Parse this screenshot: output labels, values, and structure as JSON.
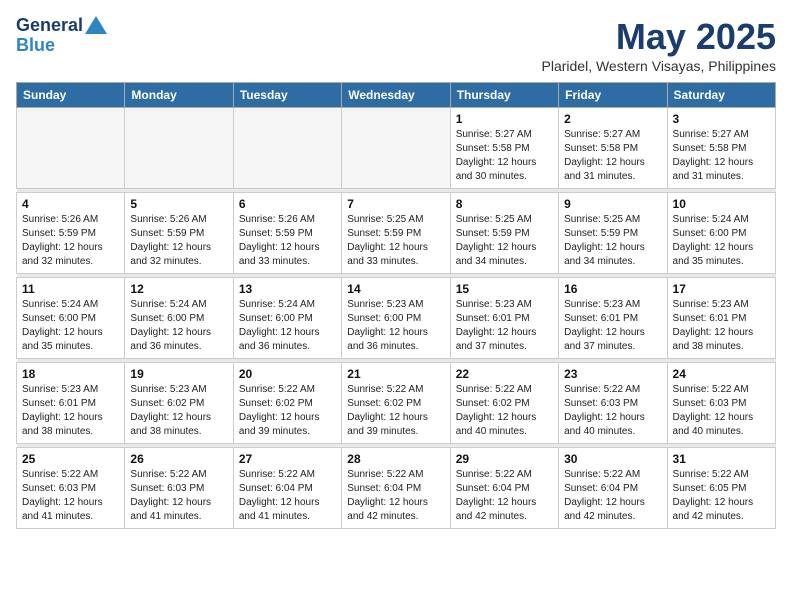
{
  "logo": {
    "line1": "General",
    "line2": "Blue"
  },
  "calendar": {
    "title": "May 2025",
    "subtitle": "Plaridel, Western Visayas, Philippines",
    "days_of_week": [
      "Sunday",
      "Monday",
      "Tuesday",
      "Wednesday",
      "Thursday",
      "Friday",
      "Saturday"
    ],
    "weeks": [
      [
        {
          "num": "",
          "info": ""
        },
        {
          "num": "",
          "info": ""
        },
        {
          "num": "",
          "info": ""
        },
        {
          "num": "",
          "info": ""
        },
        {
          "num": "1",
          "info": "Sunrise: 5:27 AM\nSunset: 5:58 PM\nDaylight: 12 hours and 30 minutes."
        },
        {
          "num": "2",
          "info": "Sunrise: 5:27 AM\nSunset: 5:58 PM\nDaylight: 12 hours and 31 minutes."
        },
        {
          "num": "3",
          "info": "Sunrise: 5:27 AM\nSunset: 5:58 PM\nDaylight: 12 hours and 31 minutes."
        }
      ],
      [
        {
          "num": "4",
          "info": "Sunrise: 5:26 AM\nSunset: 5:59 PM\nDaylight: 12 hours and 32 minutes."
        },
        {
          "num": "5",
          "info": "Sunrise: 5:26 AM\nSunset: 5:59 PM\nDaylight: 12 hours and 32 minutes."
        },
        {
          "num": "6",
          "info": "Sunrise: 5:26 AM\nSunset: 5:59 PM\nDaylight: 12 hours and 33 minutes."
        },
        {
          "num": "7",
          "info": "Sunrise: 5:25 AM\nSunset: 5:59 PM\nDaylight: 12 hours and 33 minutes."
        },
        {
          "num": "8",
          "info": "Sunrise: 5:25 AM\nSunset: 5:59 PM\nDaylight: 12 hours and 34 minutes."
        },
        {
          "num": "9",
          "info": "Sunrise: 5:25 AM\nSunset: 5:59 PM\nDaylight: 12 hours and 34 minutes."
        },
        {
          "num": "10",
          "info": "Sunrise: 5:24 AM\nSunset: 6:00 PM\nDaylight: 12 hours and 35 minutes."
        }
      ],
      [
        {
          "num": "11",
          "info": "Sunrise: 5:24 AM\nSunset: 6:00 PM\nDaylight: 12 hours and 35 minutes."
        },
        {
          "num": "12",
          "info": "Sunrise: 5:24 AM\nSunset: 6:00 PM\nDaylight: 12 hours and 36 minutes."
        },
        {
          "num": "13",
          "info": "Sunrise: 5:24 AM\nSunset: 6:00 PM\nDaylight: 12 hours and 36 minutes."
        },
        {
          "num": "14",
          "info": "Sunrise: 5:23 AM\nSunset: 6:00 PM\nDaylight: 12 hours and 36 minutes."
        },
        {
          "num": "15",
          "info": "Sunrise: 5:23 AM\nSunset: 6:01 PM\nDaylight: 12 hours and 37 minutes."
        },
        {
          "num": "16",
          "info": "Sunrise: 5:23 AM\nSunset: 6:01 PM\nDaylight: 12 hours and 37 minutes."
        },
        {
          "num": "17",
          "info": "Sunrise: 5:23 AM\nSunset: 6:01 PM\nDaylight: 12 hours and 38 minutes."
        }
      ],
      [
        {
          "num": "18",
          "info": "Sunrise: 5:23 AM\nSunset: 6:01 PM\nDaylight: 12 hours and 38 minutes."
        },
        {
          "num": "19",
          "info": "Sunrise: 5:23 AM\nSunset: 6:02 PM\nDaylight: 12 hours and 38 minutes."
        },
        {
          "num": "20",
          "info": "Sunrise: 5:22 AM\nSunset: 6:02 PM\nDaylight: 12 hours and 39 minutes."
        },
        {
          "num": "21",
          "info": "Sunrise: 5:22 AM\nSunset: 6:02 PM\nDaylight: 12 hours and 39 minutes."
        },
        {
          "num": "22",
          "info": "Sunrise: 5:22 AM\nSunset: 6:02 PM\nDaylight: 12 hours and 40 minutes."
        },
        {
          "num": "23",
          "info": "Sunrise: 5:22 AM\nSunset: 6:03 PM\nDaylight: 12 hours and 40 minutes."
        },
        {
          "num": "24",
          "info": "Sunrise: 5:22 AM\nSunset: 6:03 PM\nDaylight: 12 hours and 40 minutes."
        }
      ],
      [
        {
          "num": "25",
          "info": "Sunrise: 5:22 AM\nSunset: 6:03 PM\nDaylight: 12 hours and 41 minutes."
        },
        {
          "num": "26",
          "info": "Sunrise: 5:22 AM\nSunset: 6:03 PM\nDaylight: 12 hours and 41 minutes."
        },
        {
          "num": "27",
          "info": "Sunrise: 5:22 AM\nSunset: 6:04 PM\nDaylight: 12 hours and 41 minutes."
        },
        {
          "num": "28",
          "info": "Sunrise: 5:22 AM\nSunset: 6:04 PM\nDaylight: 12 hours and 42 minutes."
        },
        {
          "num": "29",
          "info": "Sunrise: 5:22 AM\nSunset: 6:04 PM\nDaylight: 12 hours and 42 minutes."
        },
        {
          "num": "30",
          "info": "Sunrise: 5:22 AM\nSunset: 6:04 PM\nDaylight: 12 hours and 42 minutes."
        },
        {
          "num": "31",
          "info": "Sunrise: 5:22 AM\nSunset: 6:05 PM\nDaylight: 12 hours and 42 minutes."
        }
      ]
    ]
  }
}
